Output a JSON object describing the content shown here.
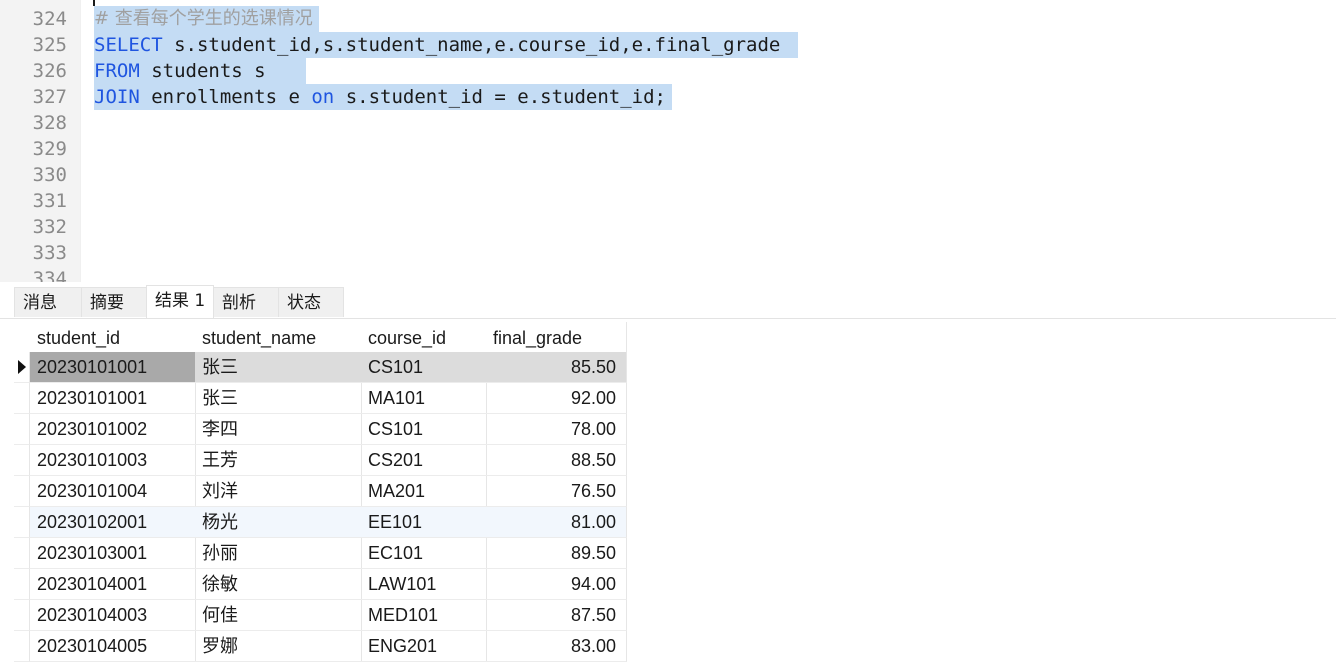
{
  "editor": {
    "lines": [
      {
        "number": "324",
        "text": "# 查看每个学生的选课情况",
        "kind": "comment",
        "selected": true
      },
      {
        "number": "325",
        "keyword": "SELECT",
        "rest": " s.student_id,s.student_name,e.course_id,e.final_grade ",
        "kind": "code",
        "selected": true
      },
      {
        "number": "326",
        "keyword": "FROM",
        "rest": " students s   ",
        "kind": "code",
        "selected": true
      },
      {
        "number": "327",
        "keyword": "JOIN",
        "rest": " enrollments e ",
        "keyword2": "on",
        "rest2": " s.student_id = e.student_id;",
        "kind": "code",
        "selected": true
      },
      {
        "number": "328"
      },
      {
        "number": "329"
      },
      {
        "number": "330"
      },
      {
        "number": "331"
      },
      {
        "number": "332"
      },
      {
        "number": "333"
      },
      {
        "number": "334"
      }
    ]
  },
  "tabs": [
    {
      "label": "消息",
      "active": false
    },
    {
      "label": "摘要",
      "active": false
    },
    {
      "label": "结果 1",
      "active": true
    },
    {
      "label": "剖析",
      "active": false
    },
    {
      "label": "状态",
      "active": false
    }
  ],
  "result": {
    "columns": [
      "student_id",
      "student_name",
      "course_id",
      "final_grade"
    ],
    "rows": [
      [
        "20230101001",
        "张三",
        "CS101",
        "85.50"
      ],
      [
        "20230101001",
        "张三",
        "MA101",
        "92.00"
      ],
      [
        "20230101002",
        "李四",
        "CS101",
        "78.00"
      ],
      [
        "20230101003",
        "王芳",
        "CS201",
        "88.50"
      ],
      [
        "20230101004",
        "刘洋",
        "MA201",
        "76.50"
      ],
      [
        "20230102001",
        "杨光",
        "EE101",
        "81.00"
      ],
      [
        "20230103001",
        "孙丽",
        "EC101",
        "89.50"
      ],
      [
        "20230104001",
        "徐敏",
        "LAW101",
        "94.00"
      ],
      [
        "20230104003",
        "何佳",
        "MED101",
        "87.50"
      ],
      [
        "20230104005",
        "罗娜",
        "ENG201",
        "83.00"
      ]
    ],
    "selected_row": 0
  },
  "colors": {
    "selection": "#c4dcf4",
    "keyword": "#1f55e0",
    "comment": "#a0a0a0"
  }
}
